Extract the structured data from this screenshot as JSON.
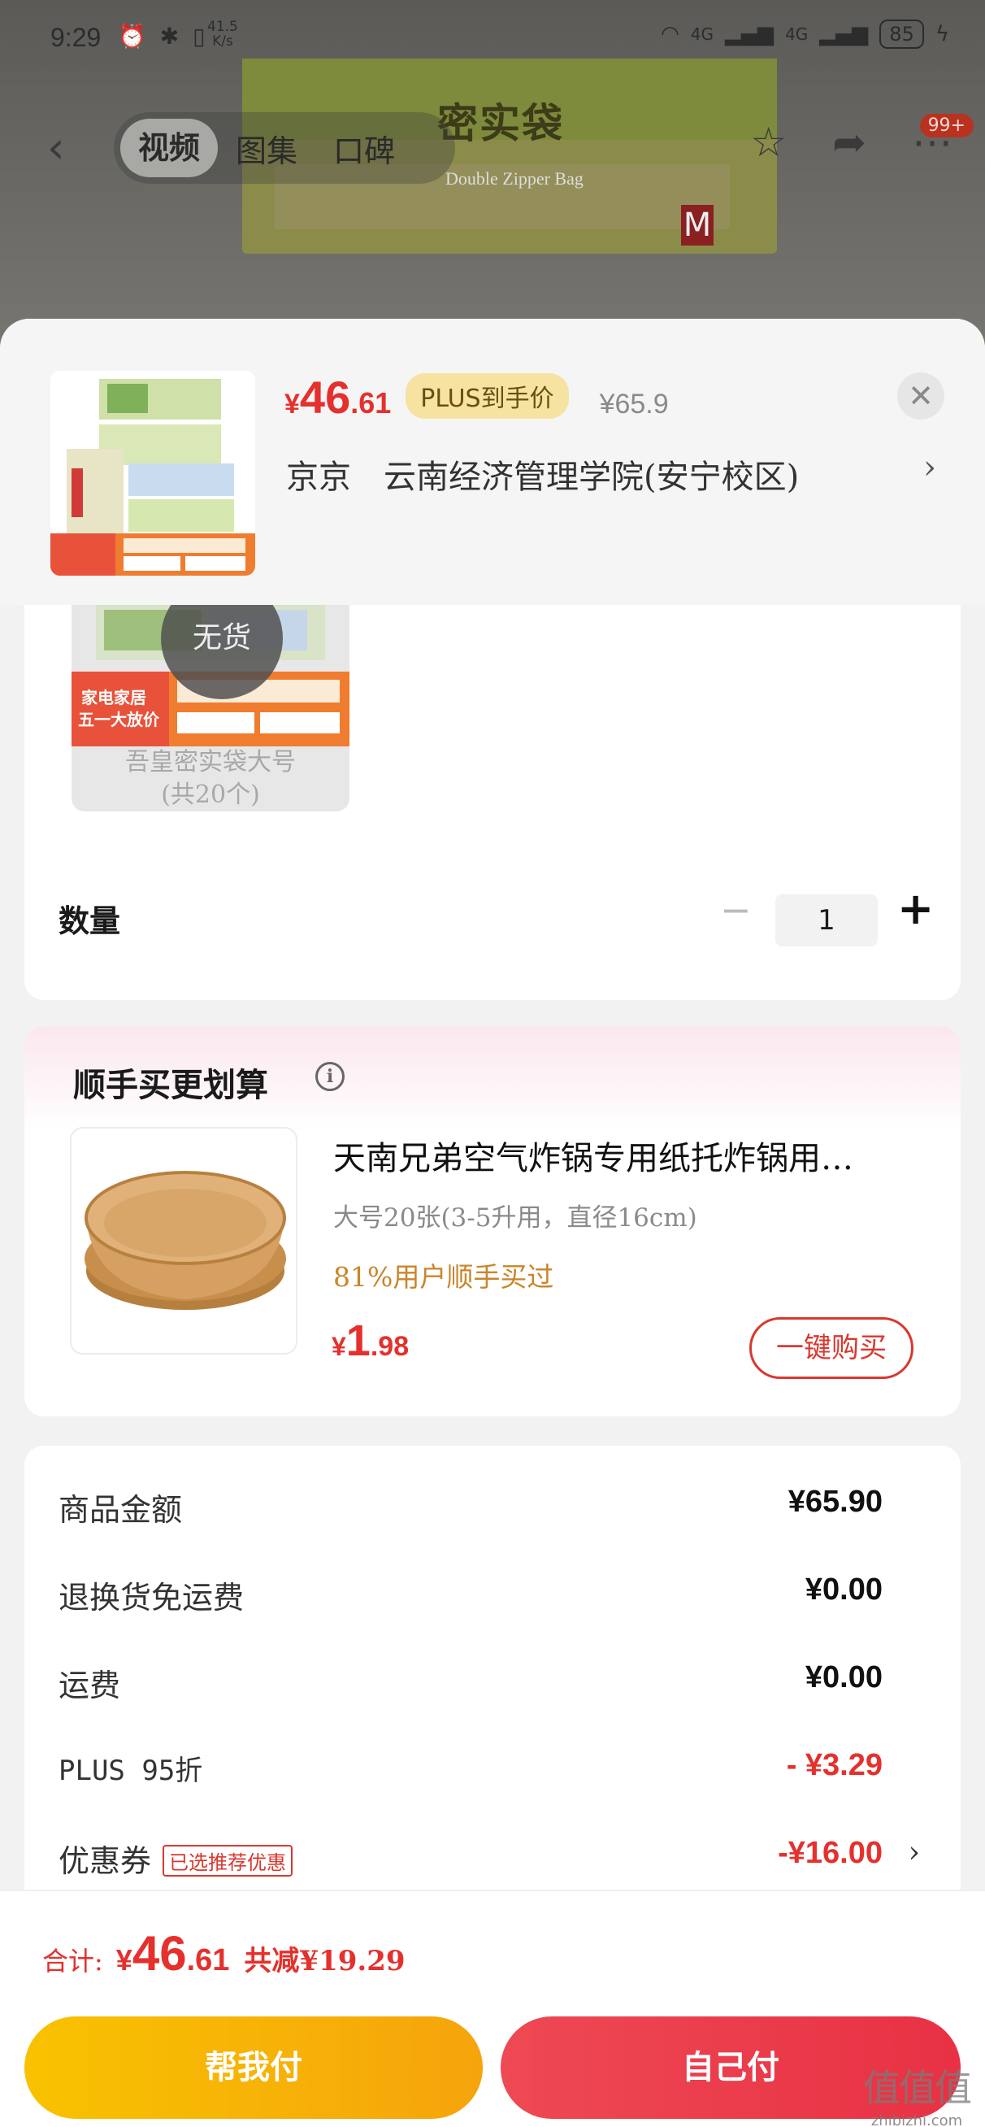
{
  "status_bar": {
    "time": "9:29",
    "speed_value": "41.5",
    "speed_unit": "K/s",
    "network_1": "4G",
    "network_2": "4G",
    "battery": "85"
  },
  "nav": {
    "tabs": [
      {
        "label": "视频",
        "active": true
      },
      {
        "label": "图集",
        "active": false
      },
      {
        "label": "口碑",
        "active": false
      }
    ],
    "badge": "99+"
  },
  "background_product": {
    "package_text_big": "密实袋",
    "package_text_en": "Double Zipper Bag",
    "size_letter": "M"
  },
  "product": {
    "price_yen": "¥",
    "price_int": "46",
    "price_dec": ".61",
    "plus_tag": "PLUS到手价",
    "original_price": "¥65.9",
    "address_city": "京京",
    "address": "云南经济管理学院(安宁校区)"
  },
  "variant": {
    "status": "无货",
    "label_line1": "吾皇密实袋大号",
    "label_line2": "(共20个)",
    "promo_line1": "家电家居",
    "promo_line2": "五一大放价"
  },
  "quantity": {
    "label": "数量",
    "value": "1",
    "minus": "−",
    "plus": "+"
  },
  "addon": {
    "title": "顺手买更划算",
    "name": "天南兄弟空气炸锅专用纸托炸锅用…",
    "spec": "大号20张(3-5升用，直径16cm)",
    "bought": "81%用户顺手买过",
    "price_yen": "¥",
    "price_int": "1",
    "price_dec": ".98",
    "button": "一键购买"
  },
  "summary": {
    "rows": [
      {
        "label": "商品金额",
        "value": "¥65.90"
      },
      {
        "label": "退换货免运费",
        "value": "¥0.00"
      },
      {
        "label": "运费",
        "value": "¥0.00"
      },
      {
        "label": "PLUS 95折",
        "value": "- ¥3.29"
      },
      {
        "label": "优惠券",
        "value": "-¥16.00",
        "tag": "已选推荐优惠"
      }
    ]
  },
  "bottom": {
    "total_label": "合计:",
    "total_yen": "¥",
    "total_int": "46",
    "total_dec": ".61",
    "total_save": "共减¥19.29",
    "btn_help": "帮我付",
    "btn_self": "自己付"
  },
  "watermark": {
    "big": "值值值",
    "small": "zhibizhi.com"
  },
  "colors": {
    "accent_red": "#e4312d",
    "plus_gold": "#f6e3a2",
    "button_yellow": "#f8c200",
    "button_red": "#e83144"
  }
}
